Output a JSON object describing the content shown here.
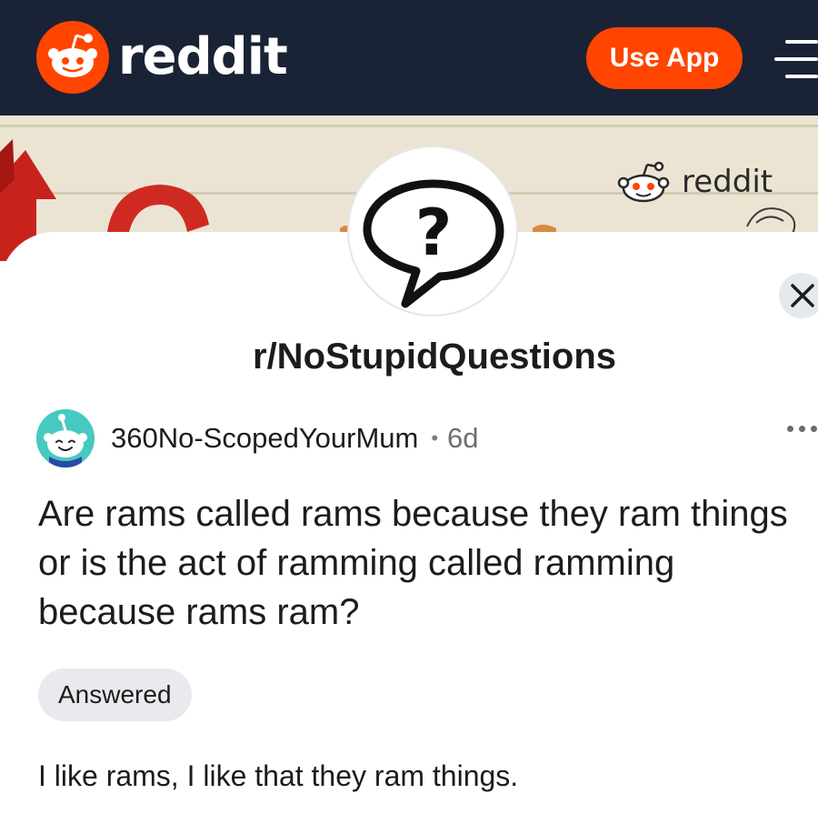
{
  "header": {
    "brand": "reddit",
    "use_app_label": "Use App",
    "icons": {
      "logo": "reddit-snoo-icon",
      "menu": "hamburger-menu-icon"
    },
    "colors": {
      "bar": "#1a2235",
      "accent": "#ff4500"
    }
  },
  "banner": {
    "brand": "reddit",
    "colors": {
      "background": "#ece4d3"
    }
  },
  "community": {
    "name": "r/NoStupidQuestions",
    "icon": "question-speech-bubble-icon"
  },
  "post": {
    "author": "360No-ScopedYourMum",
    "separator": "•",
    "age": "6d",
    "title": "Are rams called rams because they ram things or is the act of ramming called ramming because rams ram?",
    "flair": "Answered",
    "body": "I like rams, I like that they ram things."
  },
  "controls": {
    "close_icon": "close-icon",
    "more_icon": "more-options-icon"
  }
}
